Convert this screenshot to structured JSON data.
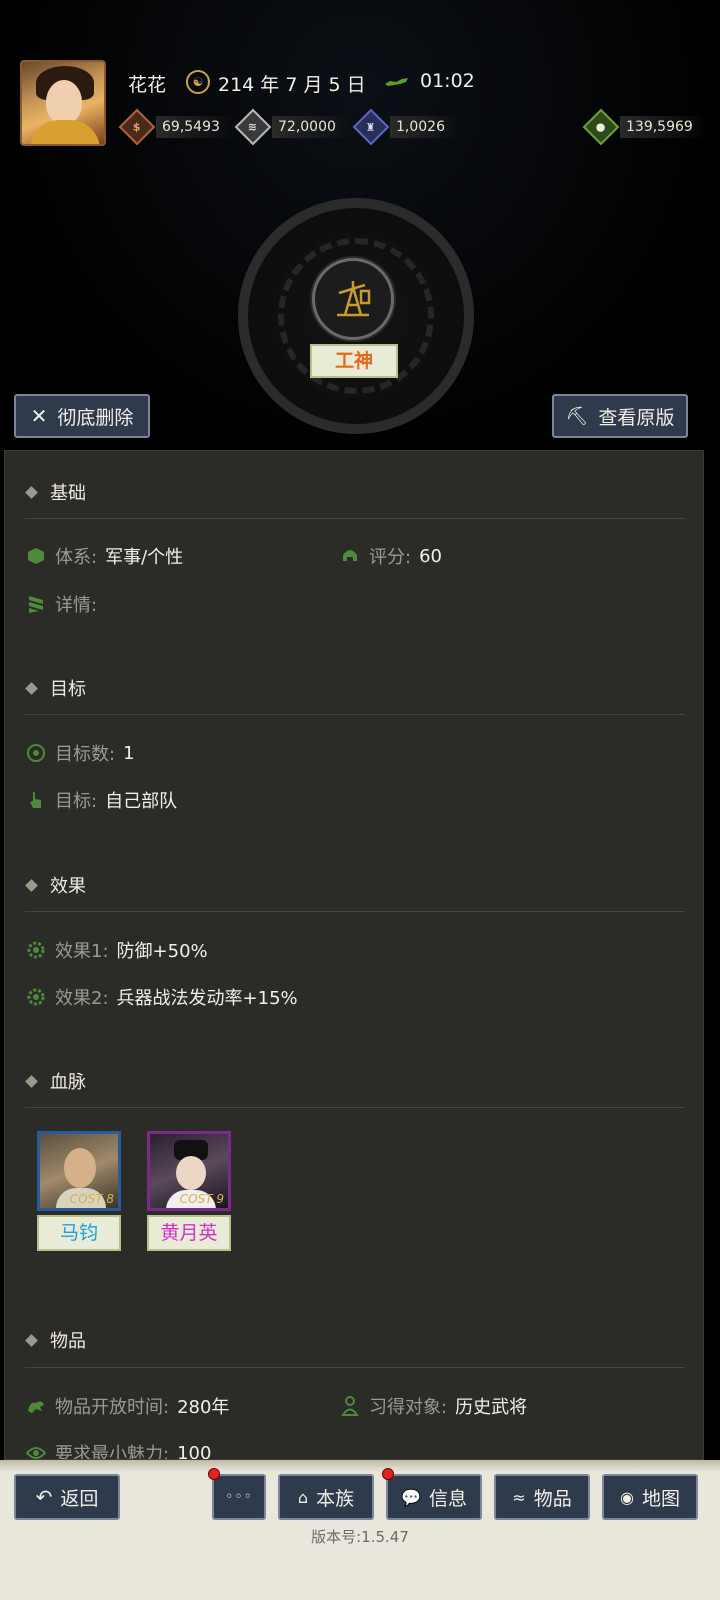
{
  "header": {
    "player_name": "花花",
    "date": "214 年 7 月 5 日",
    "time": "01:02",
    "resources": [
      {
        "icon": "coin-icon",
        "value": "69,5493",
        "color": "#b0623a"
      },
      {
        "icon": "grain-icon",
        "value": "72,0000",
        "color": "#b8b8b8"
      },
      {
        "icon": "soldier-icon",
        "value": "1,0026",
        "color": "#5a66c0"
      },
      {
        "icon": "money-bag-icon",
        "value": "139,5969",
        "color": "#6aa23a"
      }
    ]
  },
  "skill": {
    "name": "工神",
    "icon": "oil-derrick-icon"
  },
  "actions": {
    "delete_label": "彻底删除",
    "view_original_label": "查看原版"
  },
  "sections": {
    "basic": {
      "title": "基础",
      "system_label": "体系:",
      "system_value": "军事/个性",
      "score_label": "评分:",
      "score_value": "60",
      "details_label": "详情:"
    },
    "target": {
      "title": "目标",
      "count_label": "目标数:",
      "count_value": "1",
      "target_label": "目标:",
      "target_value": "自己部队"
    },
    "effect": {
      "title": "效果",
      "effect1_label": "效果1:",
      "effect1_value": "防御+50%",
      "effect2_label": "效果2:",
      "effect2_value": "兵器战法发动率+15%"
    },
    "bloodline": {
      "title": "血脉",
      "heroes": [
        {
          "name": "马钧",
          "cost": "COST 8",
          "name_color": "#1f9ee0",
          "frame_color": "#2a5a9a"
        },
        {
          "name": "黄月英",
          "cost": "COST 9",
          "name_color": "#d42fc8",
          "frame_color": "#7a2a8a"
        }
      ]
    },
    "item": {
      "title": "物品",
      "open_time_label": "物品开放时间:",
      "open_time_value": "280年",
      "learner_label": "习得对象:",
      "learner_value": "历史武将",
      "min_charm_label": "要求最小魅力:",
      "min_charm_value": "100"
    }
  },
  "nav": {
    "back": "返回",
    "more": "◦◦◦",
    "clan": "本族",
    "info": "信息",
    "items": "物品",
    "map": "地图"
  },
  "version": "版本号:1.5.47"
}
